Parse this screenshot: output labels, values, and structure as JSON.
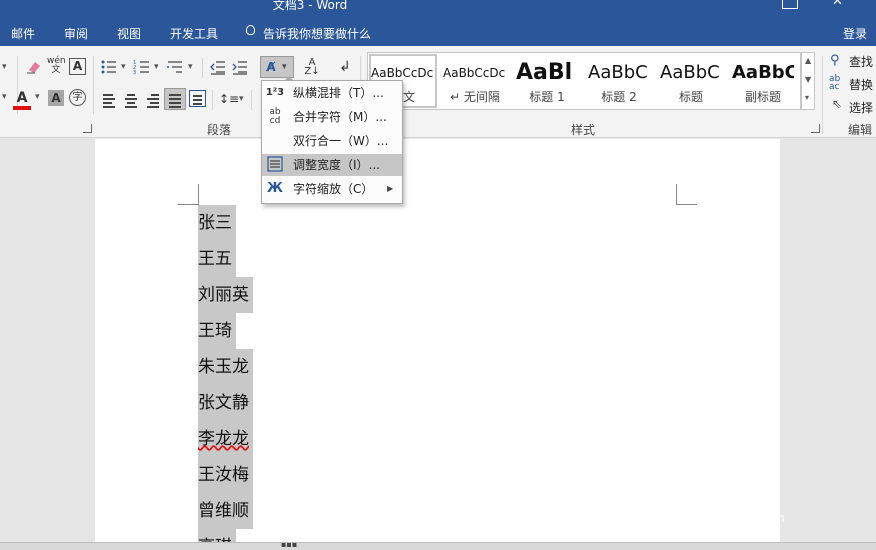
{
  "window": {
    "title": "文档3 - Word",
    "close": "✕"
  },
  "tabs": [
    "邮件",
    "审阅",
    "视图",
    "开发工具"
  ],
  "tell_me": "告诉我你想要做什么",
  "signin": "登录",
  "ribbon": {
    "groups": {
      "paragraph": "段落",
      "styles": "样式",
      "editing": "编辑"
    },
    "styles": [
      {
        "preview": "AaBbCcDc",
        "name": "正文"
      },
      {
        "preview": "AaBbCcDc",
        "name": "↵ 无间隔"
      },
      {
        "preview": "AaBl",
        "name": "标题 1"
      },
      {
        "preview": "AaBbC",
        "name": "标题 2"
      },
      {
        "preview": "AaBbC",
        "name": "标题"
      },
      {
        "preview": "AaBbC",
        "name": "副标题"
      }
    ],
    "editing": {
      "find": "查找",
      "replace": "替换",
      "select": "选择"
    }
  },
  "menu": {
    "items": [
      {
        "label": "纵横混排（T）...",
        "icon": "vertical-horizontal-icon"
      },
      {
        "label": "合并字符（M）...",
        "icon": "combine-characters-icon"
      },
      {
        "label": "双行合一（W）...",
        "icon": ""
      },
      {
        "label": "调整宽度（I）...",
        "icon": "fit-text-icon",
        "highlighted": true
      },
      {
        "label": "字符缩放（C）",
        "icon": "character-scale-icon",
        "submenu": true
      }
    ]
  },
  "document": {
    "names": [
      "张三",
      "王五",
      "刘丽英",
      "王琦",
      "朱玉龙",
      "张文静",
      "李龙龙",
      "王汝梅",
      "曾维顺",
      "高琪"
    ]
  },
  "watermark": {
    "brand": "Bai经验",
    "url": "jingyan.baidu.com"
  },
  "colors": {
    "brand": "#2b579a",
    "selection": "#c8c8c8",
    "font_color": "#e01010",
    "highlight": "#c6c6c6"
  }
}
